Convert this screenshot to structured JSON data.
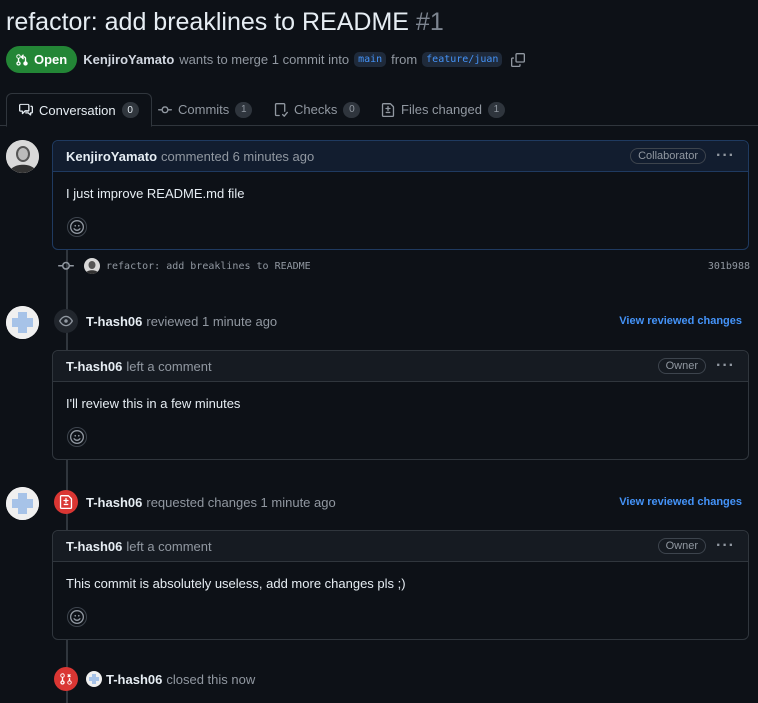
{
  "pr": {
    "title": "refactor: add breaklines to README",
    "number": "#1",
    "state": "Open",
    "author": "KenjiroYamato",
    "merge_text_1": "wants to merge 1 commit into",
    "base_branch": "main",
    "merge_text_2": "from",
    "head_branch": "feature/juan"
  },
  "tabs": [
    {
      "label": "Conversation",
      "count": "0",
      "icon": "comment-discussion-icon"
    },
    {
      "label": "Commits",
      "count": "1",
      "icon": "git-commit-icon"
    },
    {
      "label": "Checks",
      "count": "0",
      "icon": "checklist-icon"
    },
    {
      "label": "Files changed",
      "count": "1",
      "icon": "file-diff-icon"
    }
  ],
  "timeline": {
    "opening_comment": {
      "author": "KenjiroYamato",
      "action": "commented 6 minutes ago",
      "role": "Collaborator",
      "body": "I just improve README.md file"
    },
    "commit": {
      "message": "refactor: add breaklines to README",
      "sha": "301b988"
    },
    "review1": {
      "author": "T-hash06",
      "action": "reviewed 1 minute ago",
      "link": "View reviewed changes",
      "comment_author": "T-hash06",
      "comment_action": "left a comment",
      "role": "Owner",
      "body": "I'll review this in a few minutes"
    },
    "review2": {
      "author": "T-hash06",
      "action": "requested changes 1 minute ago",
      "link": "View reviewed changes",
      "comment_author": "T-hash06",
      "comment_action": "left a comment",
      "role": "Owner",
      "body": "This commit is absolutely useless, add more changes pls ;)"
    },
    "closed": {
      "author": "T-hash06",
      "action": "closed this now"
    }
  },
  "colors": {
    "background": "#0d1117",
    "open_green": "#238636",
    "link_blue": "#4493f8",
    "danger_red": "#da3633"
  }
}
